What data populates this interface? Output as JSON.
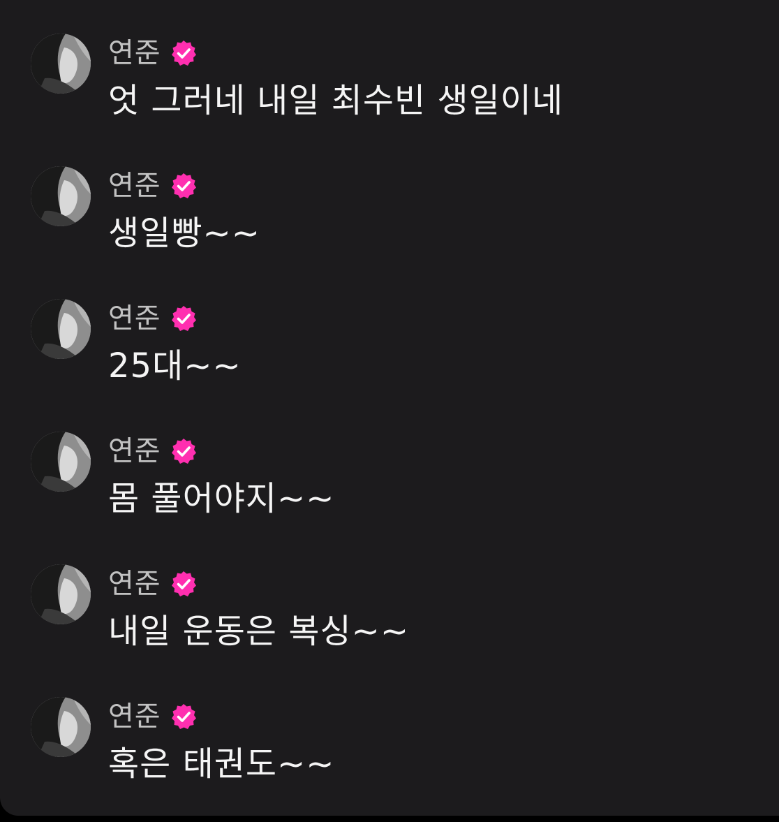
{
  "theme": {
    "background": "#1c1b1d",
    "username_color": "#c2c2c2",
    "text_color": "#f5f5f5",
    "verified_badge_color": "#ff2fb0"
  },
  "messages": [
    {
      "username": "연준",
      "verified": true,
      "avatar_icon": "profile-photo",
      "badge_icon": "verified-badge-icon",
      "text": "엇 그러네 내일 최수빈 생일이네"
    },
    {
      "username": "연준",
      "verified": true,
      "avatar_icon": "profile-photo",
      "badge_icon": "verified-badge-icon",
      "text": "생일빵~~"
    },
    {
      "username": "연준",
      "verified": true,
      "avatar_icon": "profile-photo",
      "badge_icon": "verified-badge-icon",
      "text": "25대~~"
    },
    {
      "username": "연준",
      "verified": true,
      "avatar_icon": "profile-photo",
      "badge_icon": "verified-badge-icon",
      "text": "몸 풀어야지~~"
    },
    {
      "username": "연준",
      "verified": true,
      "avatar_icon": "profile-photo",
      "badge_icon": "verified-badge-icon",
      "text": "내일 운동은 복싱~~"
    },
    {
      "username": "연준",
      "verified": true,
      "avatar_icon": "profile-photo",
      "badge_icon": "verified-badge-icon",
      "text": "혹은 태권도~~"
    }
  ]
}
